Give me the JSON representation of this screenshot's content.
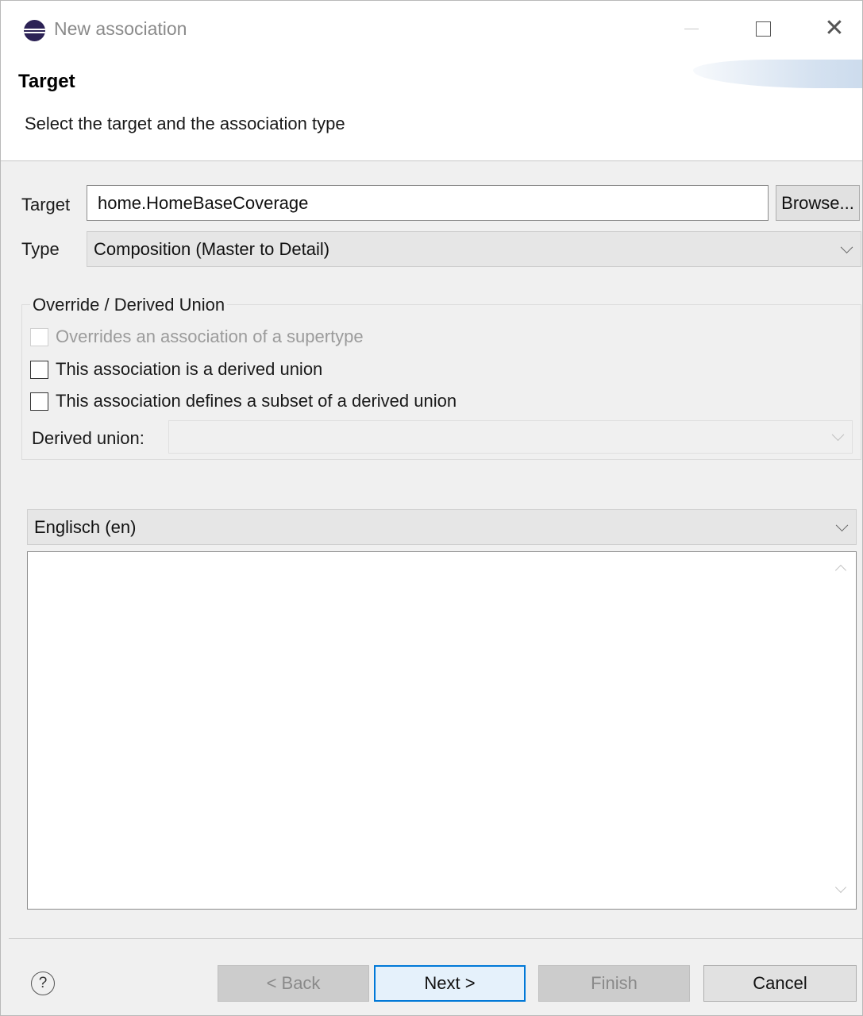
{
  "window": {
    "title": "New association"
  },
  "banner": {
    "title": "Target",
    "subtitle": "Select the target and the association type"
  },
  "form": {
    "target_label": "Target",
    "target_value": "home.HomeBaseCoverage",
    "browse_label": "Browse...",
    "type_label": "Type",
    "type_value": "Composition (Master to Detail)"
  },
  "override_group": {
    "legend": "Override / Derived Union",
    "checkboxes": [
      {
        "label": "Overrides an association of a supertype",
        "checked": false,
        "enabled": false
      },
      {
        "label": "This association is a derived union",
        "checked": false,
        "enabled": true
      },
      {
        "label": "This association defines a subset of a derived union",
        "checked": false,
        "enabled": true
      }
    ],
    "derived_union_label": "Derived union:",
    "derived_union_value": ""
  },
  "description": {
    "language": "Englisch (en)",
    "text": ""
  },
  "buttons": {
    "help": "?",
    "back": "< Back",
    "next": "Next >",
    "finish": "Finish",
    "cancel": "Cancel"
  },
  "icons": {
    "app": "eclipse-icon",
    "minimize": "minimize-icon",
    "maximize": "maximize-icon",
    "close": "close-icon",
    "help": "help-icon"
  },
  "colors": {
    "focus_accent": "#0078d7",
    "dialog_bg": "#f0f0f0"
  }
}
